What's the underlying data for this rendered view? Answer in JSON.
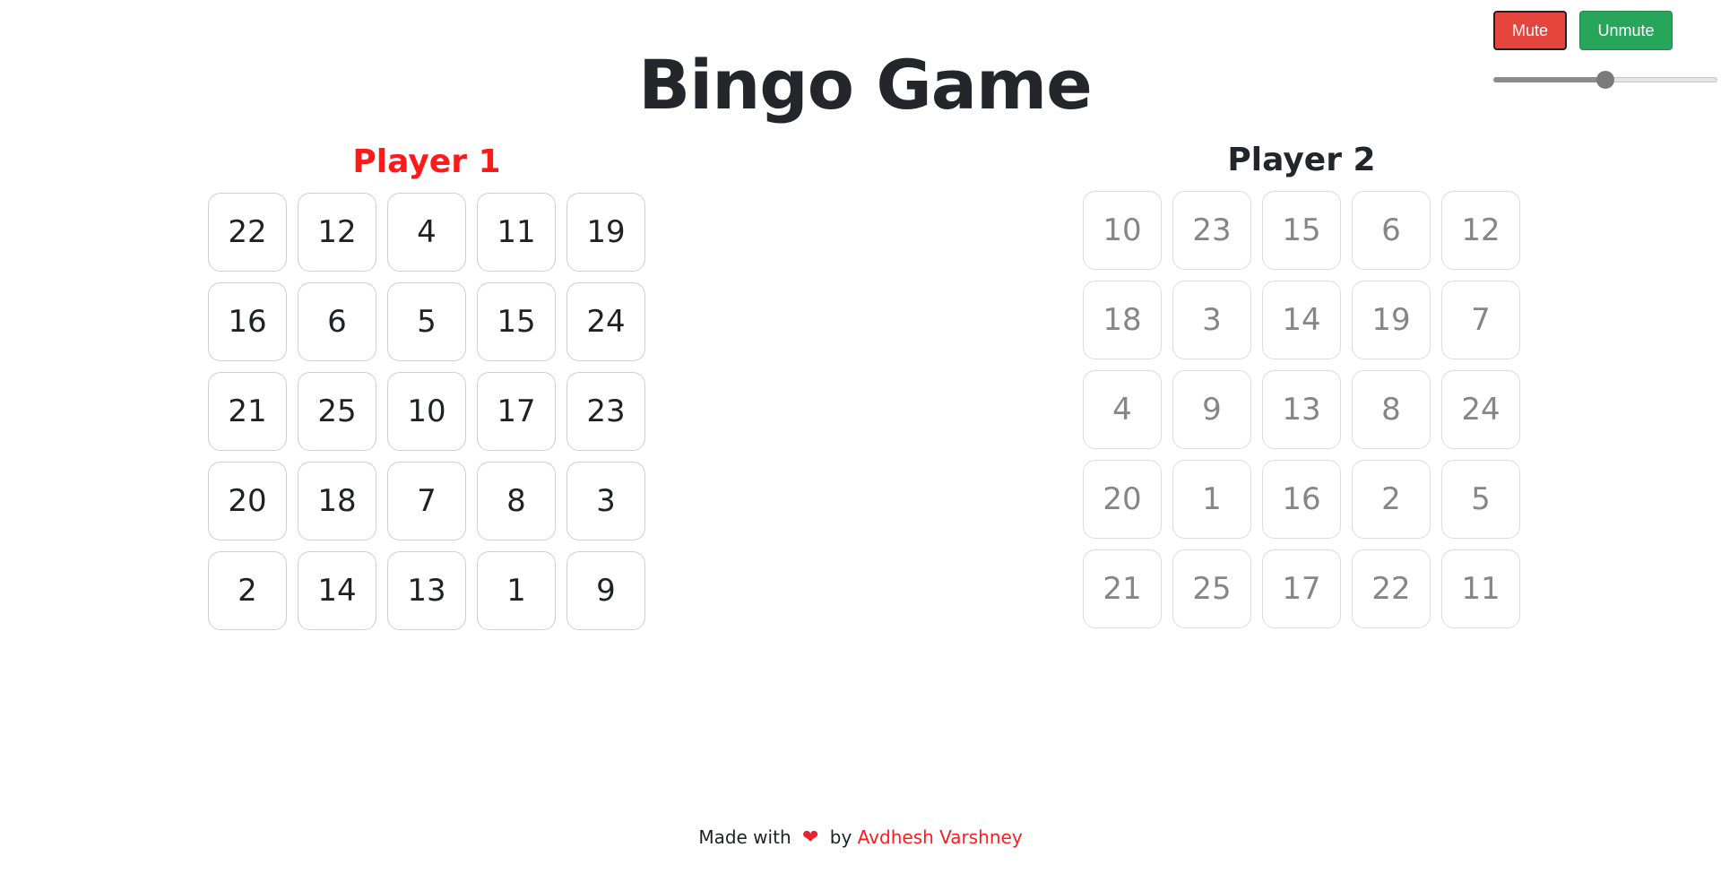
{
  "audio": {
    "mute_label": "Mute",
    "unmute_label": "Unmute",
    "volume_level": 0.5
  },
  "title": "Bingo Game",
  "players": [
    {
      "name": "Player 1",
      "grid": [
        22,
        12,
        4,
        11,
        19,
        16,
        6,
        5,
        15,
        24,
        21,
        25,
        10,
        17,
        23,
        20,
        18,
        7,
        8,
        3,
        2,
        14,
        13,
        1,
        9
      ]
    },
    {
      "name": "Player 2",
      "grid": [
        10,
        23,
        15,
        6,
        12,
        18,
        3,
        14,
        19,
        7,
        4,
        9,
        13,
        8,
        24,
        20,
        1,
        16,
        2,
        5,
        21,
        25,
        17,
        22,
        11
      ]
    }
  ],
  "footer": {
    "made_with": "Made with",
    "heart_icon": "heart-icon",
    "by": "by",
    "author": "Avdhesh Varshney"
  },
  "colors": {
    "active_player": "#ff1a1a",
    "mute_button": "#e5453c",
    "unmute_button": "#27a55a",
    "heart": "#e8232f"
  }
}
